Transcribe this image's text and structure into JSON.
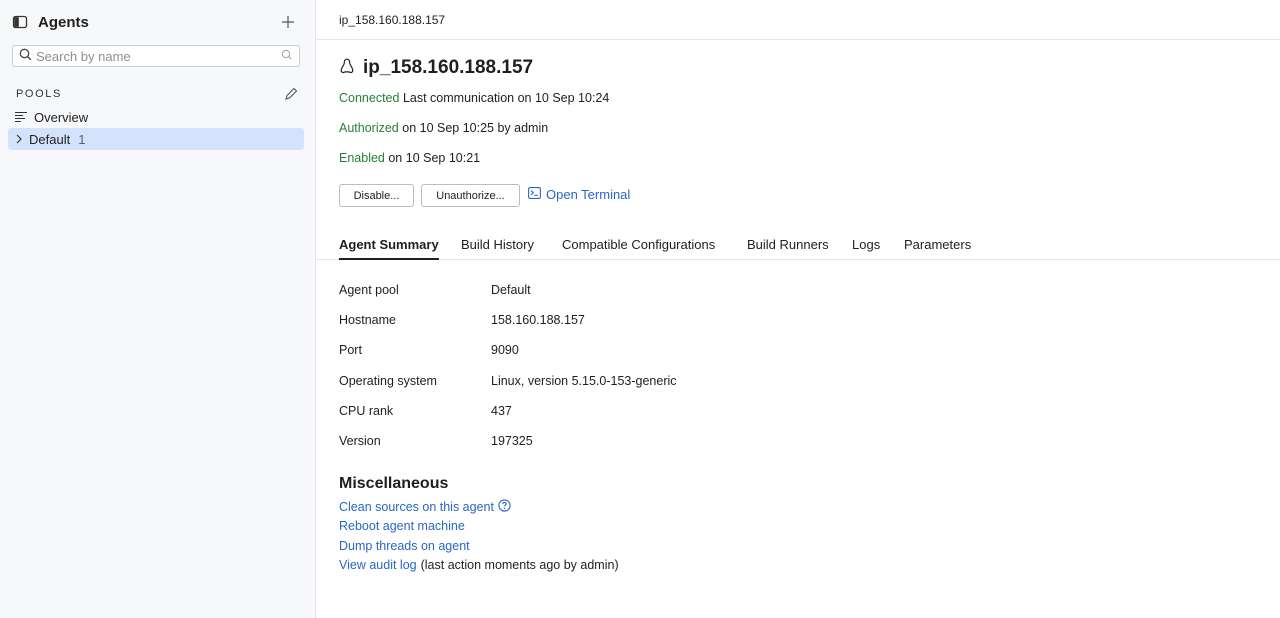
{
  "sidebar": {
    "title": "Agents",
    "search_placeholder": "Search by name",
    "pools_label": "POOLS",
    "items": [
      {
        "label": "Overview"
      },
      {
        "label": "Default",
        "count": "1"
      }
    ]
  },
  "breadcrumb": "ip_158.160.188.157",
  "agent": {
    "name": "ip_158.160.188.157",
    "connected": "Connected",
    "connected_rest": "Last communication on 10 Sep 10:24",
    "authorized": "Authorized",
    "authorized_rest": "on 10 Sep 10:25 by admin",
    "enabled": "Enabled",
    "enabled_rest": "on 10 Sep 10:21"
  },
  "actions": {
    "disable": "Disable...",
    "unauthorize": "Unauthorize...",
    "open_terminal": "Open Terminal"
  },
  "tabs": [
    {
      "label": "Agent Summary"
    },
    {
      "label": "Build History"
    },
    {
      "label": "Compatible Configurations"
    },
    {
      "label": "Build Runners"
    },
    {
      "label": "Logs"
    },
    {
      "label": "Parameters"
    }
  ],
  "summary": [
    {
      "key": "Agent pool",
      "value": "Default"
    },
    {
      "key": "Hostname",
      "value": "158.160.188.157"
    },
    {
      "key": "Port",
      "value": "9090"
    },
    {
      "key": "Operating system",
      "value": "Linux, version 5.15.0-153-generic"
    },
    {
      "key": "CPU rank",
      "value": "437"
    },
    {
      "key": "Version",
      "value": "197325"
    }
  ],
  "misc": {
    "title": "Miscellaneous",
    "clean_sources": "Clean sources on this agent",
    "reboot": "Reboot agent machine",
    "dump_threads": "Dump threads on agent",
    "audit_log": "View audit log",
    "audit_note": "(last action moments ago by admin)"
  },
  "colors": {
    "accent_link": "#2a66c4",
    "status_green": "#26803a",
    "selected_bg": "#d5e2fb"
  },
  "icons": [
    "sidebar-toggle-icon",
    "plus-icon",
    "search-icon",
    "clear-search-icon",
    "pencil-icon",
    "list-icon",
    "chevron-right-icon",
    "linux-icon",
    "terminal-icon",
    "help-icon"
  ]
}
